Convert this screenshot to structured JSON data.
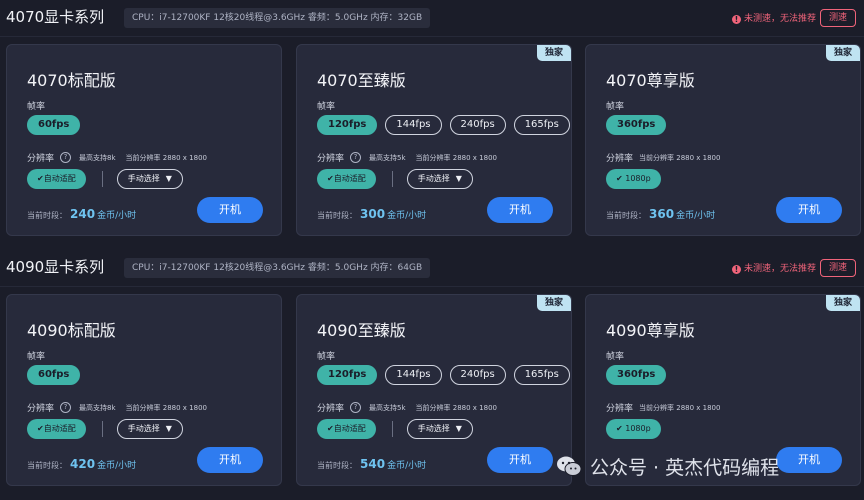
{
  "sections": [
    {
      "title": "4070显卡系列",
      "spec": "CPU：i7-12700KF 12核20线程@3.6GHz 睿频：5.0GHz 内存：32GB",
      "warning": "未测速，无法推荐",
      "test_label": "测速",
      "cards": [
        {
          "title": "4070标配版",
          "badge": "",
          "fps_label": "帧率",
          "fps": [
            "60fps"
          ],
          "fps_active": 0,
          "res_label": "分辨率",
          "res_max": "最高支持8k",
          "res_current": "当前分辨率 2880 x 1800",
          "show_modes": true,
          "auto_label": "✔自动适配",
          "manual_label": "手动选择",
          "price_prefix": "当前时段：",
          "price": "240",
          "price_unit": "金币/小时",
          "open_label": "开机"
        },
        {
          "title": "4070至臻版",
          "badge": "独家",
          "fps_label": "帧率",
          "fps": [
            "120fps",
            "144fps",
            "240fps",
            "165fps"
          ],
          "fps_active": 0,
          "res_label": "分辨率",
          "res_max": "最高支持5k",
          "res_current": "当前分辨率 2880 x 1800",
          "show_modes": true,
          "auto_label": "✔自动适配",
          "manual_label": "手动选择",
          "price_prefix": "当前时段：",
          "price": "300",
          "price_unit": "金币/小时",
          "open_label": "开机"
        },
        {
          "title": "4070尊享版",
          "badge": "独家",
          "fps_label": "帧率",
          "fps": [
            "360fps"
          ],
          "fps_active": 0,
          "res_label": "分辨率",
          "res_max": "",
          "res_current": "当前分辨率 2880 x 1800",
          "show_modes": false,
          "auto_label": "✔ 1080p",
          "manual_label": "",
          "price_prefix": "当前时段：",
          "price": "360",
          "price_unit": "金币/小时",
          "open_label": "开机"
        }
      ]
    },
    {
      "title": "4090显卡系列",
      "spec": "CPU：i7-12700KF 12核20线程@3.6GHz 睿频：5.0GHz 内存：64GB",
      "warning": "未测速，无法推荐",
      "test_label": "测速",
      "cards": [
        {
          "title": "4090标配版",
          "badge": "",
          "fps_label": "帧率",
          "fps": [
            "60fps"
          ],
          "fps_active": 0,
          "res_label": "分辨率",
          "res_max": "最高支持8k",
          "res_current": "当前分辨率 2880 x 1800",
          "show_modes": true,
          "auto_label": "✔自动适配",
          "manual_label": "手动选择",
          "price_prefix": "当前时段：",
          "price": "420",
          "price_unit": "金币/小时",
          "open_label": "开机"
        },
        {
          "title": "4090至臻版",
          "badge": "独家",
          "fps_label": "帧率",
          "fps": [
            "120fps",
            "144fps",
            "240fps",
            "165fps"
          ],
          "fps_active": 0,
          "res_label": "分辨率",
          "res_max": "最高支持5k",
          "res_current": "当前分辨率 2880 x 1800",
          "show_modes": true,
          "auto_label": "✔自动适配",
          "manual_label": "手动选择",
          "price_prefix": "当前时段：",
          "price": "540",
          "price_unit": "金币/小时",
          "open_label": "开机"
        },
        {
          "title": "4090尊享版",
          "badge": "独家",
          "fps_label": "帧率",
          "fps": [
            "360fps"
          ],
          "fps_active": 0,
          "res_label": "分辨率",
          "res_max": "",
          "res_current": "当前分辨率 2880 x 1800",
          "show_modes": false,
          "auto_label": "✔ 1080p",
          "manual_label": "",
          "price_prefix": "当前时段：",
          "price": "",
          "price_unit": "",
          "open_label": "开机"
        }
      ]
    }
  ],
  "watermark": "公众号 · 英杰代码编程",
  "colors": {
    "accent": "#3fb3a8",
    "primary": "#2f7cf0",
    "warning": "#f0647a",
    "price": "#6fc3f0",
    "background": "#1b1d29",
    "card": "#272a3b"
  }
}
